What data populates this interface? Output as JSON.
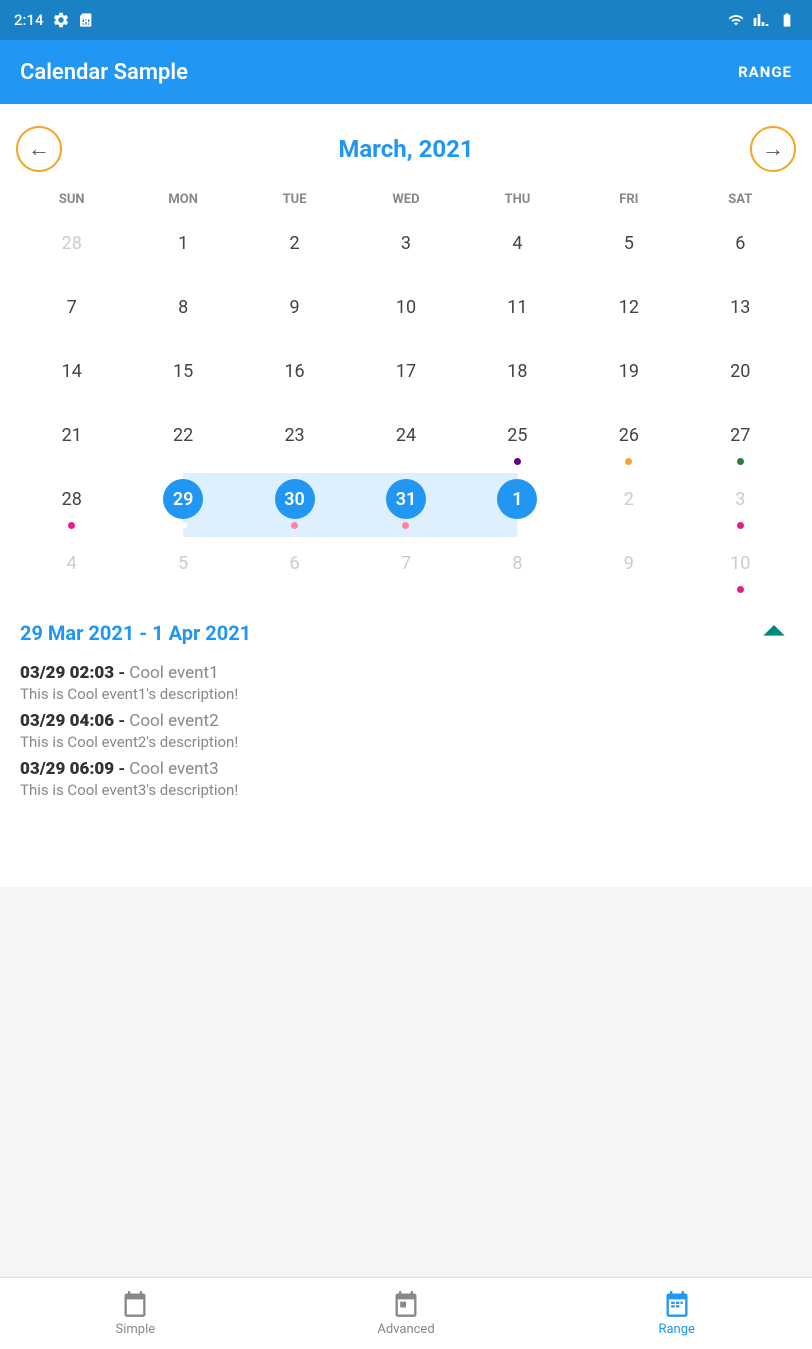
{
  "statusBar": {
    "time": "2:14",
    "icons": [
      "settings",
      "sim",
      "wifi",
      "signal",
      "battery"
    ]
  },
  "appBar": {
    "title": "Calendar Sample",
    "action": "RANGE"
  },
  "calendar": {
    "monthTitle": "March, 2021",
    "dayHeaders": [
      "SUN",
      "MON",
      "TUE",
      "WED",
      "THU",
      "FRI",
      "SAT"
    ],
    "prevLabel": "←",
    "nextLabel": "→"
  },
  "eventsSection": {
    "dateRange": "29 Mar 2021 - 1 Apr 2021",
    "events": [
      {
        "time": "03/29 02:03",
        "name": "Cool event1",
        "description": "This is Cool event1's description!"
      },
      {
        "time": "03/29 04:06",
        "name": "Cool event2",
        "description": "This is Cool event2's description!"
      },
      {
        "time": "03/29 06:09",
        "name": "Cool event3",
        "description": "This is Cool event3's description!"
      }
    ]
  },
  "bottomNav": {
    "items": [
      {
        "label": "Simple",
        "active": false
      },
      {
        "label": "Advanced",
        "active": false
      },
      {
        "label": "Range",
        "active": true
      }
    ]
  }
}
